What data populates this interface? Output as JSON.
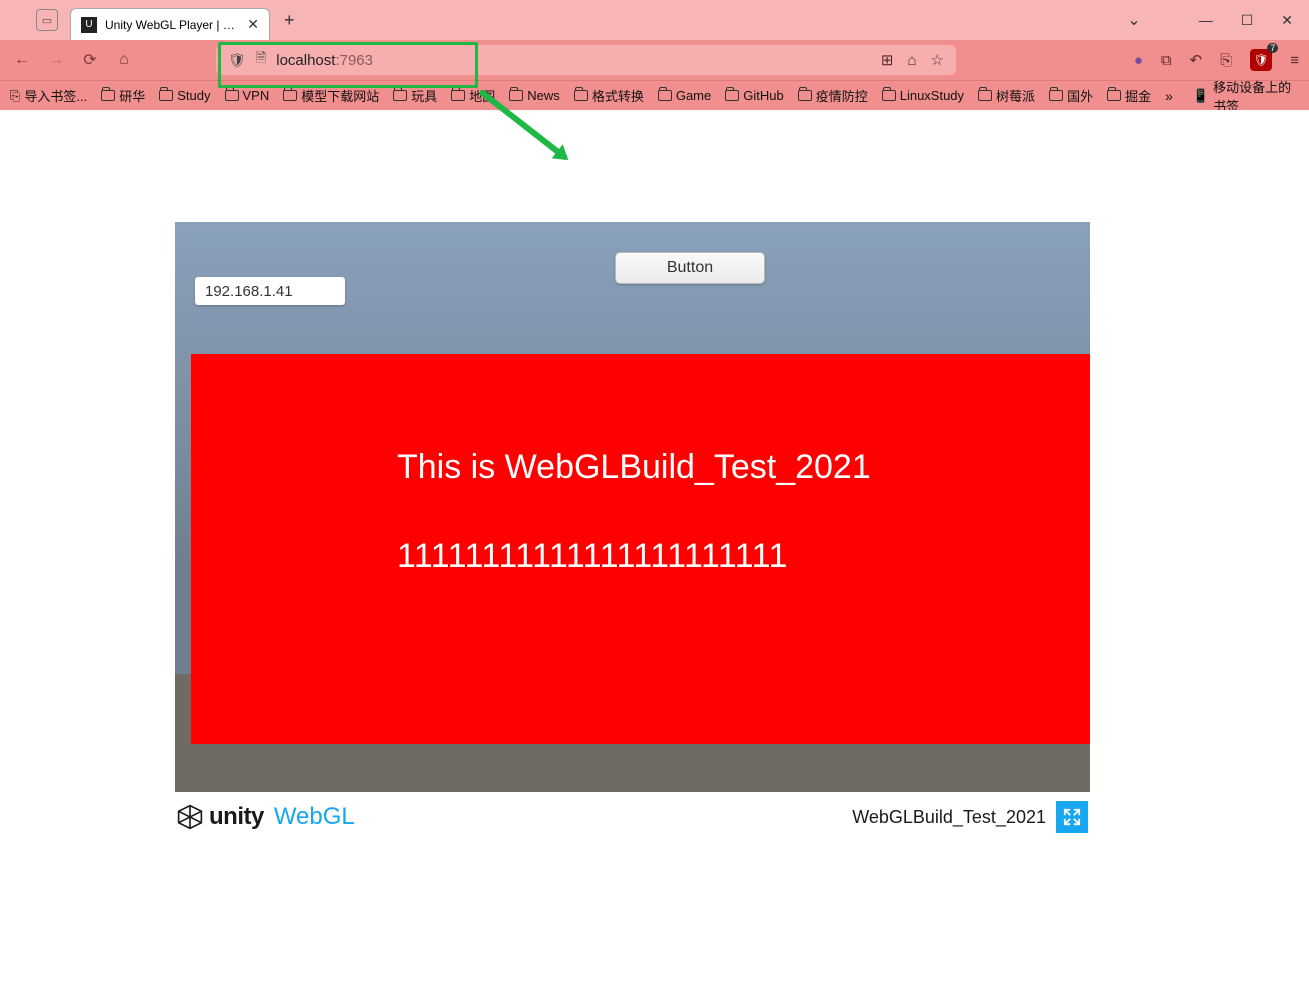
{
  "window": {
    "tab_title": "Unity WebGL Player | WebGL…",
    "minimize": "—",
    "maximize": "☐",
    "close": "✕",
    "dropdown": "⌄",
    "newtab": "+"
  },
  "address": {
    "host": "localhost",
    "port": ":7963"
  },
  "right_icons": {
    "qr": "⊞",
    "home": "⌂",
    "star": "☆",
    "account_dot": "●",
    "ext1": "⧉",
    "undo": "↶",
    "pocket": "⎘",
    "ublock_badge": "7",
    "menu": "≡"
  },
  "bookmarks": [
    "导入书签...",
    "研华",
    "Study",
    "VPN",
    "模型下载网站",
    "玩具",
    "地图",
    "News",
    "格式转换",
    "Game",
    "GitHub",
    "疫情防控",
    "LinuxStudy",
    "树莓派",
    "国外",
    "掘金"
  ],
  "bookmarks_mobile": "移动设备上的书签",
  "unity": {
    "ip_text": "192.168.1.41",
    "button_label": "Button",
    "panel_line1": "This is WebGLBuild_Test_2021",
    "panel_line2": "11111111111111111111111"
  },
  "footer": {
    "logo_unity": "unity",
    "logo_webgl": "WebGL",
    "build_name": "WebGLBuild_Test_2021"
  }
}
